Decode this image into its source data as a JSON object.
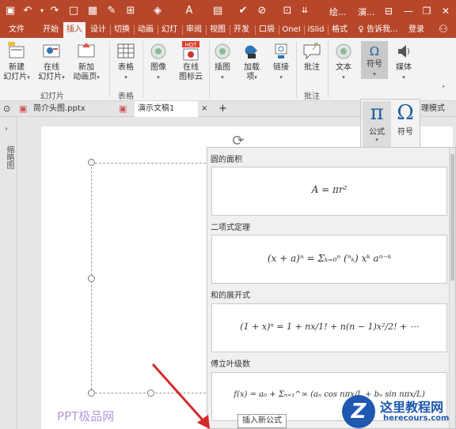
{
  "title_bar": {
    "title_short": "绘...",
    "title_short2": "演...",
    "sign_in": "登录"
  },
  "ribbon_tabs": [
    "文件",
    "开始",
    "插入",
    "设计",
    "切换",
    "动画",
    "幻灯",
    "审阅",
    "视图",
    "开发",
    "口袋",
    "OneI",
    "iSlid",
    "格式"
  ],
  "active_tab": "插入",
  "tell_me": "告诉我...",
  "share_label": "",
  "ribbon": {
    "new_slide": [
      "新建",
      "幻灯片"
    ],
    "online_slide": [
      "在线",
      "幻灯片"
    ],
    "new_animation_page": [
      "新加",
      "动画页"
    ],
    "table": "表格",
    "image": "图像",
    "online_icon": [
      "在线",
      "图标云"
    ],
    "illustration": "插图",
    "addins": [
      "加载",
      "项"
    ],
    "link": "链接",
    "comment": "批注",
    "text": "文本",
    "symbol": "符号",
    "media": "媒体",
    "hot_badge": "HOT",
    "groups": {
      "slides": "幻灯片",
      "tables": "表格",
      "comments": "批注"
    }
  },
  "doc_tabs": [
    {
      "name": "简介头图.pptx"
    },
    {
      "name": "演示文稿1"
    }
  ],
  "doc_tab_close": "×",
  "doc_tab_add": "+",
  "view_mode_partial": "理模式",
  "symbols_popup": {
    "equation_label": "公式",
    "symbol_label": "符号",
    "equation_glyph": "π",
    "symbol_glyph": "Ω"
  },
  "gallery": {
    "items": [
      {
        "title": "圆的面积",
        "formula": "A = πr²"
      },
      {
        "title": "二项式定理",
        "formula": "(x + a)ⁿ = Σₖ₌₀ⁿ (ⁿₖ) xᵏ aⁿ⁻ᵏ"
      },
      {
        "title": "和的展开式",
        "formula": "(1 + x)ⁿ = 1 + nx/1! + n(n − 1)x²/2! + ⋯"
      },
      {
        "title": "傅立叶级数",
        "formula": "f(x) = a₀ + Σₙ₌₁^∞ (aₙ cos nπx/L + bₙ sin nπx/L)"
      }
    ],
    "insert_new_tooltip": "插入新公式"
  },
  "left_pane_label": "缩略图",
  "watermark": "PPT极品网",
  "logo": {
    "name": "这里教程网",
    "url": "herecours.com"
  }
}
